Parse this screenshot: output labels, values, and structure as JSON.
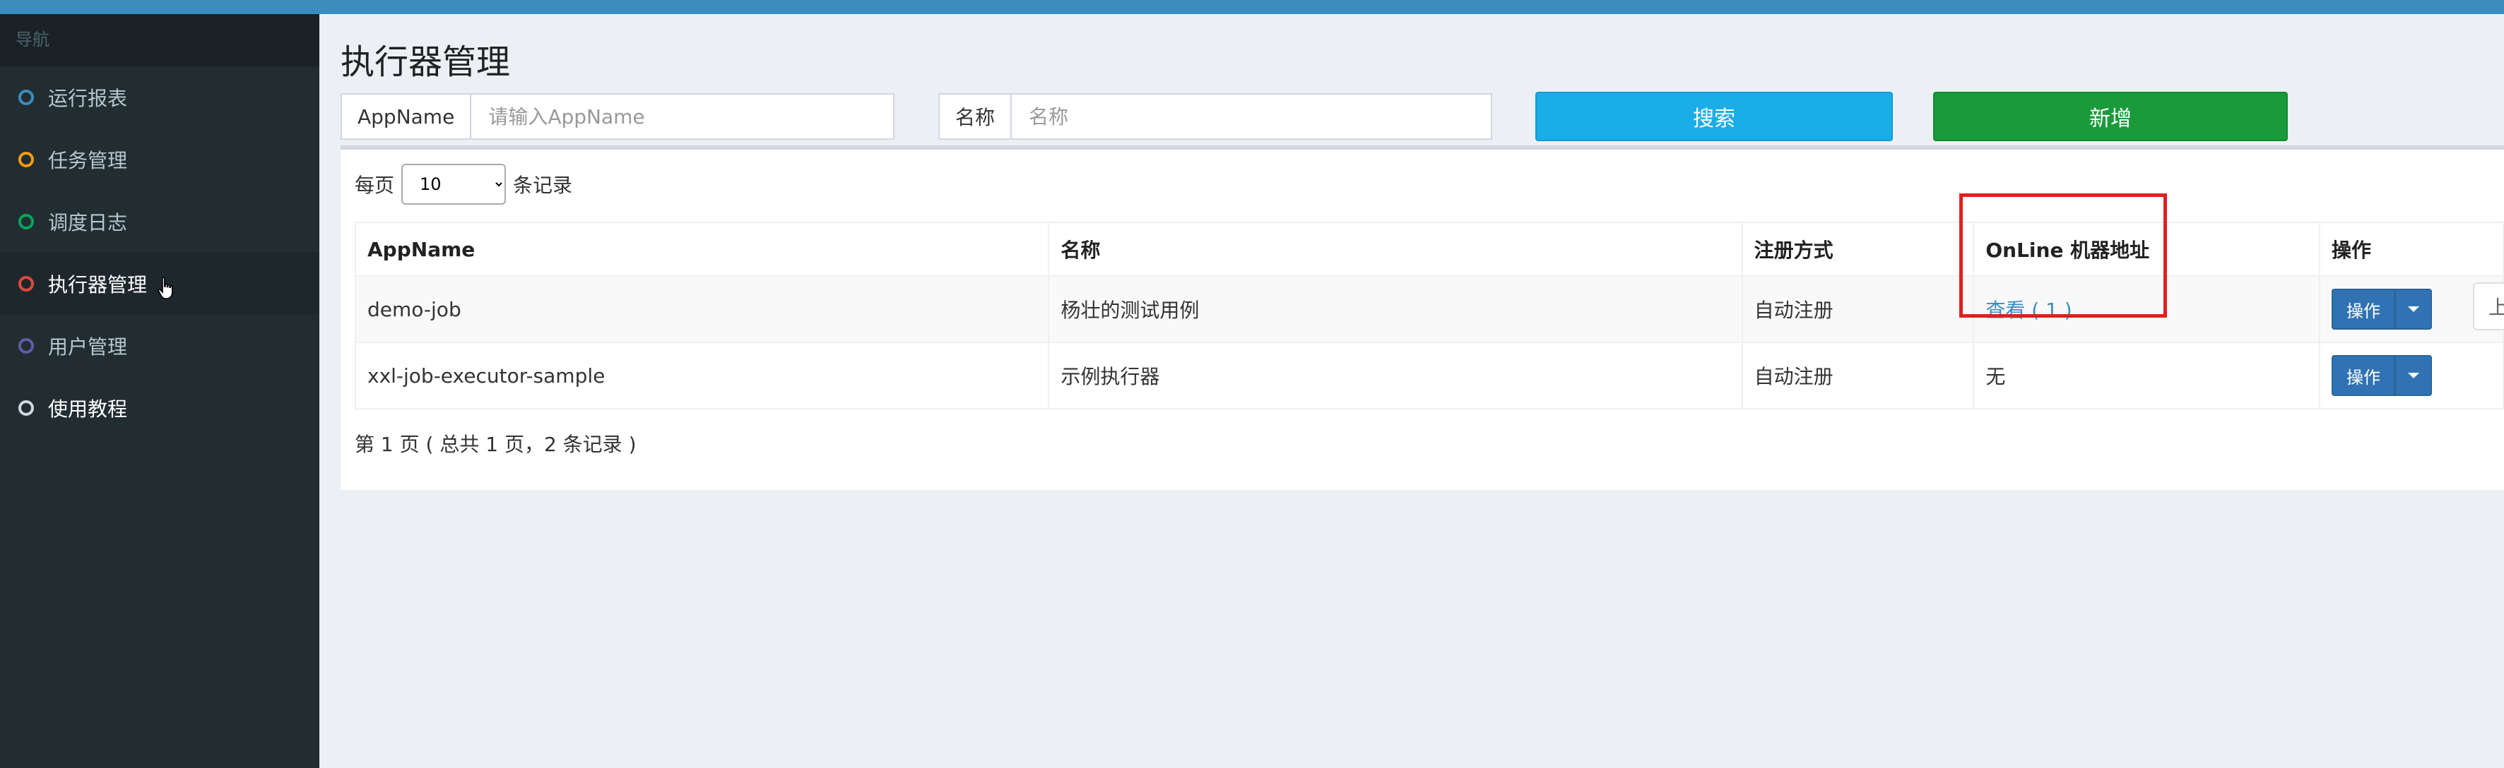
{
  "sidebar": {
    "header": "导航",
    "items": [
      {
        "label": "运行报表",
        "color": "#3c8dbc"
      },
      {
        "label": "任务管理",
        "color": "#f39c12"
      },
      {
        "label": "调度日志",
        "color": "#00a65a"
      },
      {
        "label": "执行器管理",
        "color": "#dd4b39"
      },
      {
        "label": "用户管理",
        "color": "#605ca8"
      },
      {
        "label": "使用教程",
        "color": "#d2d6de"
      }
    ]
  },
  "page": {
    "title": "执行器管理"
  },
  "filters": {
    "appname_label": "AppName",
    "appname_placeholder": "请输入AppName",
    "name_label": "名称",
    "name_placeholder": "名称",
    "search_label": "搜索",
    "add_label": "新增"
  },
  "table": {
    "length_prefix": "每页",
    "length_value": "10",
    "length_suffix": "条记录",
    "headers": [
      "AppName",
      "名称",
      "注册方式",
      "OnLine 机器地址",
      "操作"
    ],
    "rows": [
      {
        "appname": "demo-job",
        "name": "杨壮的测试用例",
        "reg": "自动注册",
        "online": "查看 ( 1 )",
        "op": "操作"
      },
      {
        "appname": "xxl-job-executor-sample",
        "name": "示例执行器",
        "reg": "自动注册",
        "online": "无",
        "op": "操作"
      }
    ],
    "info": "第 1 页 ( 总共 1 页，2 条记录 )",
    "prev_label": "上"
  },
  "colors": {
    "highlight": "#e02020",
    "search": "#1aade8",
    "add": "#1a9a3b",
    "operate": "#3173b2"
  }
}
